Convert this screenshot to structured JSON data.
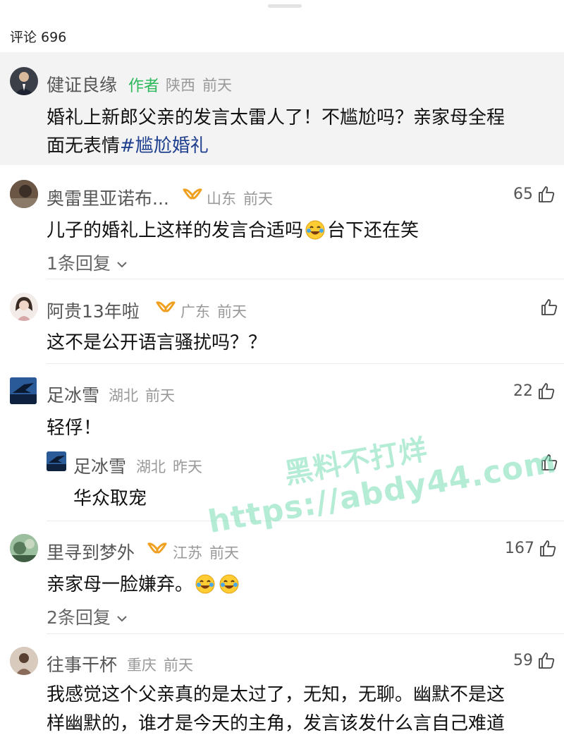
{
  "header": {
    "comments_label": "评论 696"
  },
  "pinned": {
    "user": "健证良缘",
    "author_tag": "作者",
    "region": "陕西",
    "time": "前天",
    "text_line1": "婚礼上新郎父亲的发言太雷人了！不尴尬吗？亲家母全程",
    "text_line2_plain": "面无表情",
    "hashtag": "#尴尬婚礼"
  },
  "comments": [
    {
      "user": "奥雷里亚诺布...",
      "region": "山东",
      "time": "前天",
      "likes": "65",
      "text_before": "儿子的婚礼上这样的发言合适吗",
      "text_after": "台下还在笑",
      "reply_toggle": "1条回复"
    },
    {
      "user": "阿贵13年啦",
      "region": "广东",
      "time": "前天",
      "likes": "",
      "text": "这不是公开语言骚扰吗？？"
    },
    {
      "user": "足冰雪",
      "region": "湖北",
      "time": "前天",
      "likes": "22",
      "text": "轻俘！",
      "reply": {
        "user": "足冰雪",
        "region": "湖北",
        "time": "昨天",
        "text": "华众取宠"
      }
    },
    {
      "user": "里寻到梦外",
      "region": "江苏",
      "time": "前天",
      "likes": "167",
      "text": "亲家母一脸嫌弃。",
      "reply_toggle": "2条回复"
    },
    {
      "user": "往事干杯",
      "region": "重庆",
      "time": "前天",
      "likes": "59",
      "text_line1": "我感觉这个父亲真的是太过了，无知，无聊。幽默不是这",
      "text_line2": "样幽默的，谁才是今天的主角，发言该发什么言自己难道"
    }
  ],
  "watermark": {
    "line1": "黑料不打烊",
    "line2": "https://abdy44.com"
  },
  "colors": {
    "author_green": "#2eb85c",
    "hashtag_blue": "#1f3f8f",
    "vip_orange": "#f0a020",
    "bg_pinned": "#f3f3f3"
  },
  "icons": [
    "thumbs-up-icon",
    "vip-badge-icon",
    "chevron-down-icon",
    "laugh-cry-emoji"
  ]
}
